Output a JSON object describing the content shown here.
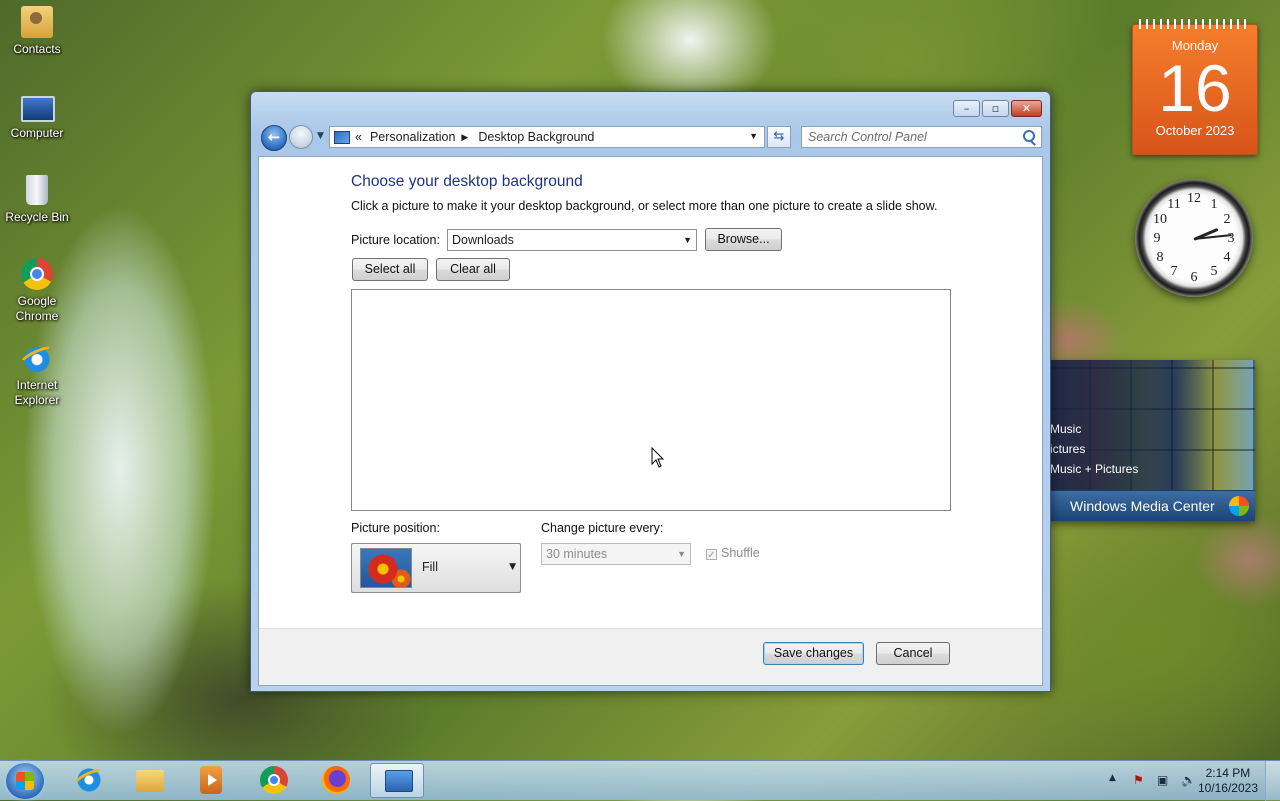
{
  "desktop": {
    "icons": [
      {
        "label": "Contacts"
      },
      {
        "label": "Computer"
      },
      {
        "label": "Recycle Bin"
      },
      {
        "label": "Google Chrome"
      },
      {
        "label": "Internet Explorer"
      }
    ]
  },
  "gadgets": {
    "calendar": {
      "weekday": "Monday",
      "day": "16",
      "month_year": "October 2023"
    },
    "clock": {
      "numbers": [
        "12",
        "1",
        "2",
        "3",
        "4",
        "5",
        "6",
        "7",
        "8",
        "9",
        "10",
        "11"
      ]
    },
    "media_center": {
      "items": [
        "Music",
        "ictures",
        "Music + Pictures"
      ],
      "title": "Windows Media Center"
    }
  },
  "window": {
    "breadcrumb": {
      "overflow": "«",
      "items": [
        "Personalization",
        "Desktop Background"
      ]
    },
    "search_placeholder": "Search Control Panel",
    "heading": "Choose your desktop background",
    "intro": "Click a picture to make it your desktop background, or select more than one picture to create a slide show.",
    "picture_location": {
      "label": "Picture location:",
      "value": "Downloads"
    },
    "browse_label": "Browse...",
    "select_all_label": "Select all",
    "clear_all_label": "Clear all",
    "picture_position": {
      "label": "Picture position:",
      "value": "Fill"
    },
    "change_picture": {
      "label": "Change picture every:",
      "value": "30 minutes"
    },
    "shuffle": {
      "label": "Shuffle",
      "checked": true
    },
    "save_label": "Save changes",
    "cancel_label": "Cancel"
  },
  "taskbar": {
    "time": "2:14 PM",
    "date": "10/16/2023"
  }
}
